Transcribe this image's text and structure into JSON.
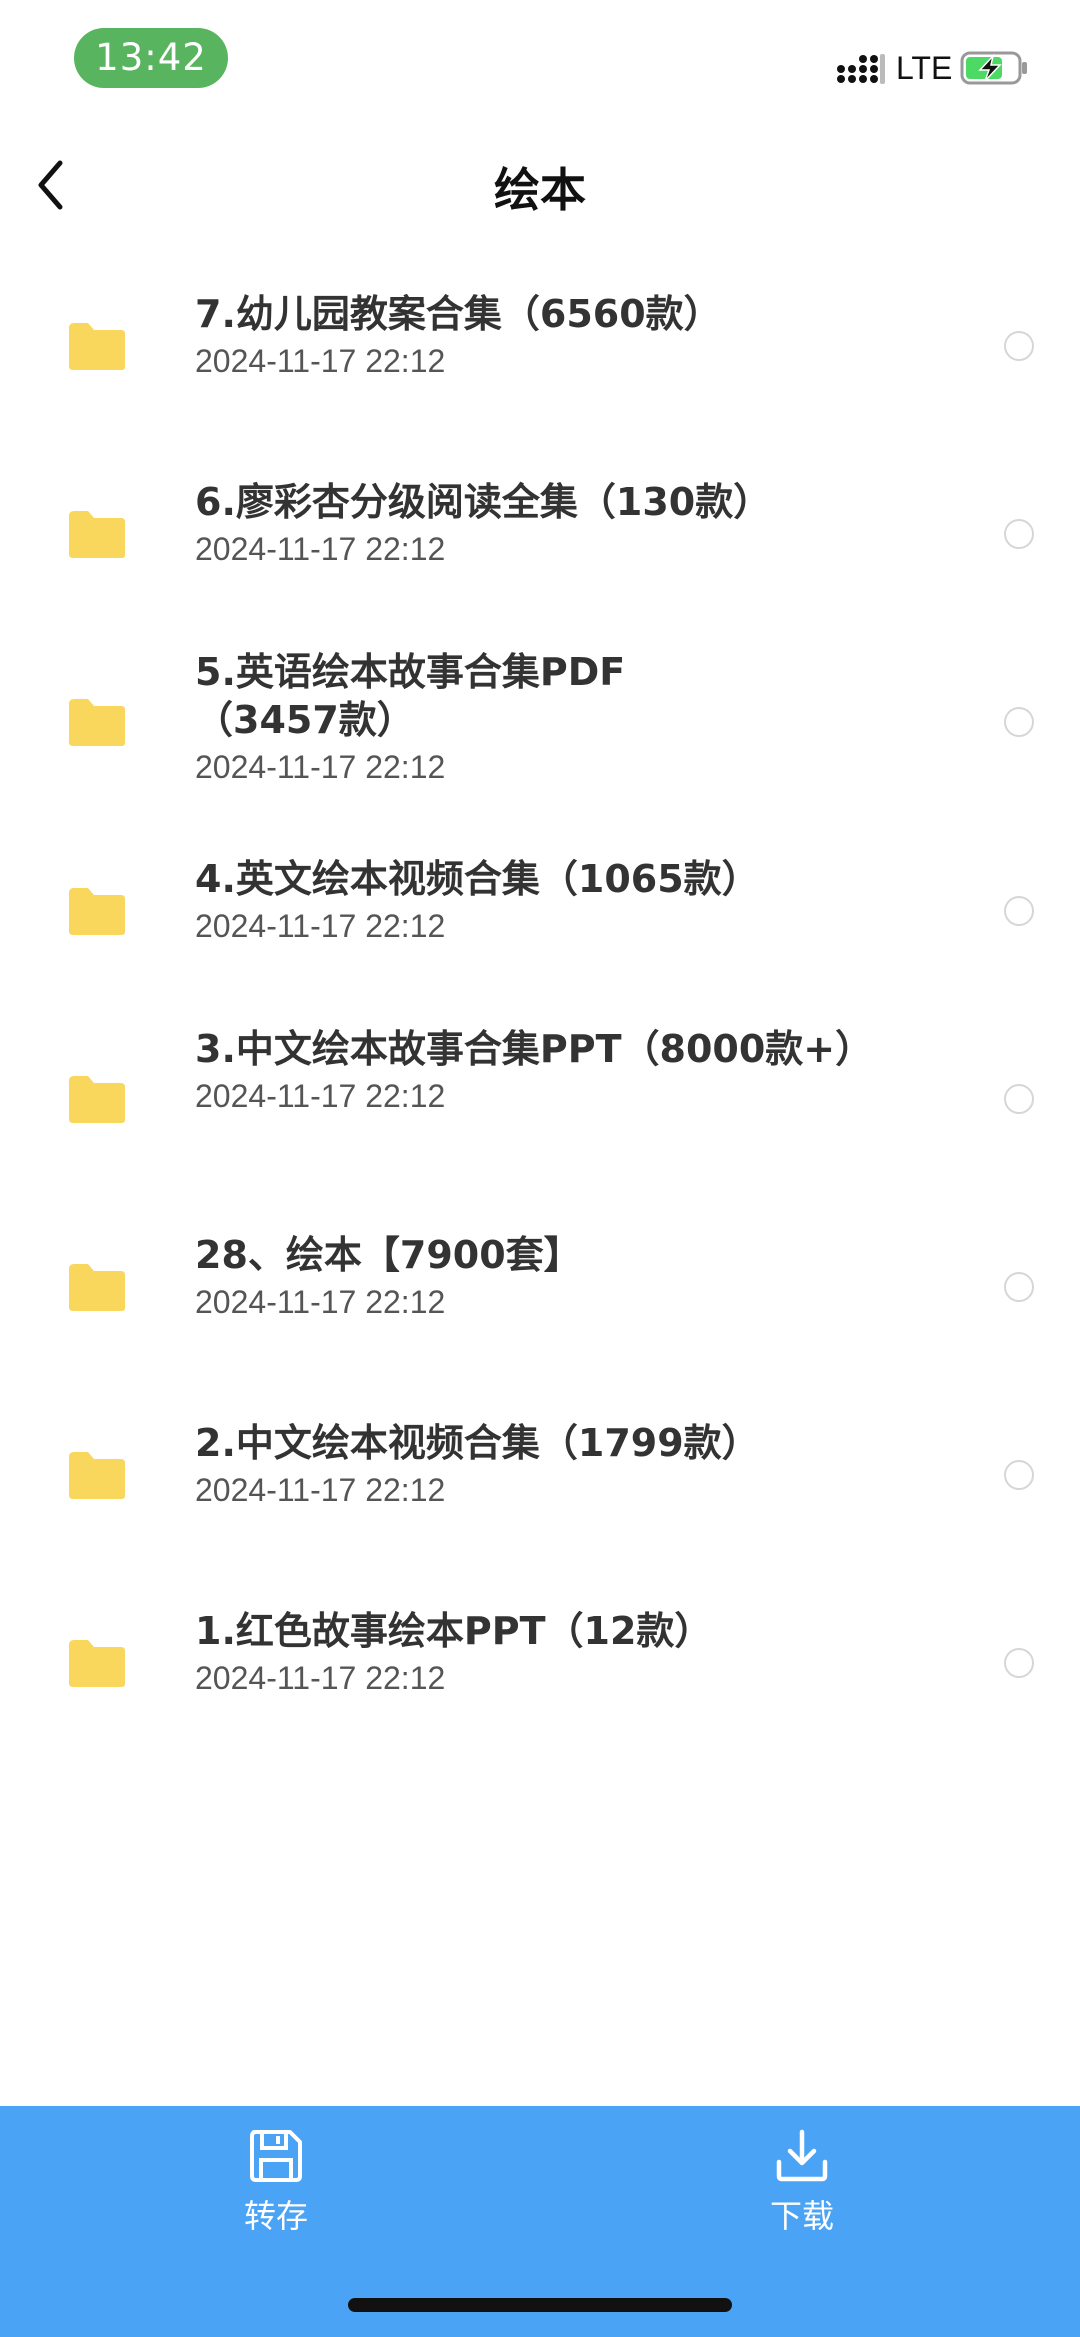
{
  "status_bar": {
    "time": "13:42",
    "network": "LTE"
  },
  "header": {
    "title": "绘本"
  },
  "files": [
    {
      "name": "7.幼儿园教案合集（6560款）",
      "date": "2024-11-17 22:12"
    },
    {
      "name": "6.廖彩杏分级阅读全集（130款）",
      "date": "2024-11-17 22:12"
    },
    {
      "name": "5.英语绘本故事合集PDF（3457款）",
      "date": "2024-11-17 22:12"
    },
    {
      "name": "4.英文绘本视频合集（1065款）",
      "date": "2024-11-17 22:12"
    },
    {
      "name": "3.中文绘本故事合集PPT（8000款+）",
      "date": "2024-11-17 22:12"
    },
    {
      "name": "28、绘本【7900套】",
      "date": "2024-11-17 22:12"
    },
    {
      "name": "2.中文绘本视频合集（1799款）",
      "date": "2024-11-17 22:12"
    },
    {
      "name": "1.红色故事绘本PPT（12款）",
      "date": "2024-11-17 22:12"
    }
  ],
  "bottom_bar": {
    "save_label": "转存",
    "download_label": "下载"
  },
  "colors": {
    "accent": "#4aa3f5",
    "folder": "#f9d65c",
    "time_pill": "#59b45f"
  }
}
